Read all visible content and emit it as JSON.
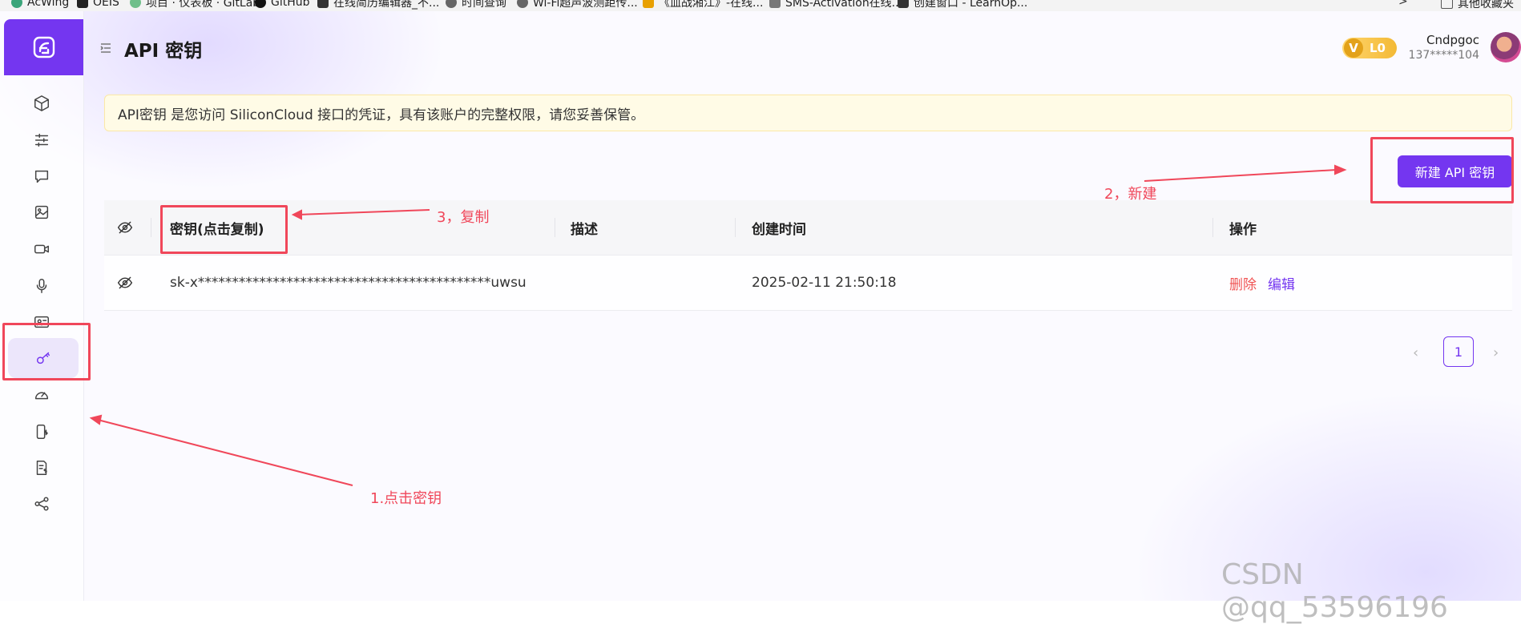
{
  "bookmarks": [
    {
      "label": "AcWing",
      "icon": "acwing-icon"
    },
    {
      "label": "OEIS",
      "icon": "oeis-icon"
    },
    {
      "label": "项目 · 仪表板 · GitLab",
      "icon": "gitlab-icon"
    },
    {
      "label": "GitHub",
      "icon": "github-icon"
    },
    {
      "label": "在线简历编辑器_不...",
      "icon": "resume-icon"
    },
    {
      "label": "时间查询",
      "icon": "clock-icon"
    },
    {
      "label": "Wi-Fi超声波测距传...",
      "icon": "wifi-icon"
    },
    {
      "label": "《血战湘江》-在线...",
      "icon": "video-icon"
    },
    {
      "label": "SMS-Activation在线...",
      "icon": "sms-icon"
    },
    {
      "label": "创建窗口 - LearnOp...",
      "icon": "learnopengl-icon"
    }
  ],
  "bookmarks_more": ">",
  "bookmarks_folder": "其他收藏夹",
  "header": {
    "title": "API 密钥"
  },
  "user": {
    "level": "L0",
    "vip_letter": "V",
    "name": "Cndpgoc",
    "phone": "137*****104"
  },
  "notice": "API密钥 是您访问 SiliconCloud 接口的凭证，具有该账户的完整权限，请您妥善保管。",
  "new_button": "新建 API 密钥",
  "table": {
    "columns": [
      "密钥(点击复制)",
      "描述",
      "创建时间",
      "操作"
    ],
    "rows": [
      {
        "key": "sk-x*******************************************uwsu",
        "description": "",
        "created": "2025-02-11 21:50:18",
        "delete": "删除",
        "edit": "编辑"
      }
    ]
  },
  "pagination": {
    "current": "1",
    "prev": "‹",
    "next": "›"
  },
  "annotations": {
    "step1": "1.点击密钥",
    "step2": "2，新建",
    "step3": "3，复制",
    "color": "#f0475a"
  },
  "watermark": "CSDN @qq_53596196",
  "colors": {
    "accent": "#7436f0",
    "danger": "#f05454",
    "notice_bg": "#fffbe6"
  },
  "sidebar_icons": [
    "cube-icon",
    "sliders-icon",
    "chat-icon",
    "image-icon",
    "video-icon",
    "microphone-icon",
    "id-card-icon",
    "key-icon",
    "gauge-icon",
    "billing-phone-icon",
    "invoice-icon",
    "share-icon"
  ]
}
